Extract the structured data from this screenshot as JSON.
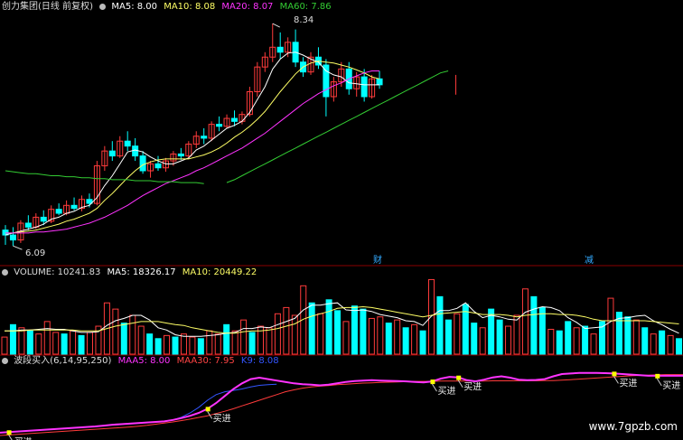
{
  "colors": {
    "up": "#ff3b3b",
    "down": "#00ffff",
    "ma5": "#ffffff",
    "ma10": "#ffff66",
    "ma20": "#ff33ff",
    "ma60": "#33cc33",
    "vol_ma5": "#ffffff",
    "vol_ma10": "#ffff66",
    "maa5": "#ff33ff",
    "maa30": "#ff3b3b",
    "k_line": "#3355ff",
    "signal": "#ffff00",
    "divider": "#8b0000"
  },
  "price_panel": {
    "title": "创力集团(日线 前复权)",
    "ma5_label": "MA5: 8.00",
    "ma10_label": "MA10: 8.08",
    "ma20_label": "MA20: 8.07",
    "ma60_label": "MA60: 7.86",
    "high_label": "8.34",
    "low_label": "6.09",
    "event_label_1": "财",
    "event_label_2": "减"
  },
  "volume_panel": {
    "vol_label": "VOLUME: 10241.83",
    "ma5_label": "MA5: 18326.17",
    "ma10_label": "MA10: 20449.22"
  },
  "wave_panel": {
    "title": "波段买入(6,14,95,250)",
    "maa5_label": "MAA5: 8.00",
    "maa30_label": "MAA30: 7.95",
    "k_label": "K9: 8.08",
    "buy_label": "买进"
  },
  "watermark": "www.7gpzb.com",
  "chart_data": {
    "type": "candlestick",
    "price_ylim": [
      6.0,
      8.45
    ],
    "candles": [
      [
        6.25,
        6.3,
        6.1,
        6.2
      ],
      [
        6.2,
        6.28,
        6.09,
        6.15
      ],
      [
        6.15,
        6.35,
        6.12,
        6.32
      ],
      [
        6.32,
        6.4,
        6.25,
        6.28
      ],
      [
        6.28,
        6.42,
        6.26,
        6.38
      ],
      [
        6.38,
        6.45,
        6.3,
        6.34
      ],
      [
        6.34,
        6.5,
        6.32,
        6.46
      ],
      [
        6.46,
        6.52,
        6.4,
        6.42
      ],
      [
        6.42,
        6.55,
        6.4,
        6.5
      ],
      [
        6.5,
        6.58,
        6.45,
        6.47
      ],
      [
        6.47,
        6.6,
        6.44,
        6.56
      ],
      [
        6.56,
        6.62,
        6.48,
        6.52
      ],
      [
        6.52,
        6.95,
        6.5,
        6.9
      ],
      [
        6.9,
        7.1,
        6.85,
        7.05
      ],
      [
        7.05,
        7.15,
        6.95,
        7.0
      ],
      [
        7.0,
        7.2,
        6.98,
        7.15
      ],
      [
        7.15,
        7.25,
        7.05,
        7.1
      ],
      [
        7.1,
        7.18,
        6.95,
        7.0
      ],
      [
        7.0,
        7.05,
        6.82,
        6.85
      ],
      [
        6.85,
        6.95,
        6.78,
        6.92
      ],
      [
        6.92,
        7.0,
        6.85,
        6.88
      ],
      [
        6.88,
        6.98,
        6.84,
        6.95
      ],
      [
        6.95,
        7.05,
        6.9,
        7.02
      ],
      [
        7.02,
        7.08,
        6.96,
        7.0
      ],
      [
        7.0,
        7.15,
        6.98,
        7.12
      ],
      [
        7.12,
        7.25,
        7.08,
        7.2
      ],
      [
        7.2,
        7.28,
        7.12,
        7.18
      ],
      [
        7.18,
        7.35,
        7.15,
        7.32
      ],
      [
        7.32,
        7.4,
        7.25,
        7.3
      ],
      [
        7.3,
        7.42,
        7.28,
        7.38
      ],
      [
        7.38,
        7.46,
        7.3,
        7.35
      ],
      [
        7.35,
        7.45,
        7.32,
        7.42
      ],
      [
        7.42,
        7.7,
        7.4,
        7.65
      ],
      [
        7.65,
        7.95,
        7.6,
        7.9
      ],
      [
        7.9,
        8.05,
        7.85,
        8.0
      ],
      [
        8.0,
        8.34,
        7.95,
        8.1
      ],
      [
        8.1,
        8.25,
        7.98,
        8.05
      ],
      [
        8.05,
        8.2,
        8.0,
        8.15
      ],
      [
        8.15,
        8.28,
        7.9,
        7.95
      ],
      [
        7.95,
        8.0,
        7.8,
        7.85
      ],
      [
        7.85,
        8.05,
        7.82,
        8.0
      ],
      [
        8.0,
        8.1,
        7.88,
        7.92
      ],
      [
        7.92,
        7.98,
        7.4,
        7.6
      ],
      [
        7.6,
        7.8,
        7.55,
        7.75
      ],
      [
        7.75,
        7.95,
        7.7,
        7.88
      ],
      [
        7.88,
        7.95,
        7.62,
        7.68
      ],
      [
        7.68,
        7.85,
        7.6,
        7.8
      ],
      [
        7.8,
        7.88,
        7.55,
        7.6
      ],
      [
        7.6,
        7.82,
        7.58,
        7.78
      ],
      [
        7.78,
        7.86,
        7.68,
        7.72
      ]
    ],
    "ma5": [
      6.2,
      6.22,
      6.24,
      6.26,
      6.28,
      6.31,
      6.36,
      6.38,
      6.42,
      6.44,
      6.48,
      6.5,
      6.58,
      6.7,
      6.8,
      6.92,
      7.04,
      7.06,
      7.04,
      6.99,
      6.95,
      6.92,
      6.92,
      6.95,
      6.98,
      7.06,
      7.1,
      7.16,
      7.22,
      7.28,
      7.31,
      7.35,
      7.44,
      7.57,
      7.7,
      7.88,
      7.98,
      8.04,
      8.05,
      8.02,
      7.98,
      7.95,
      7.86,
      7.82,
      7.8,
      7.74,
      7.73,
      7.72,
      7.72,
      7.72
    ],
    "ma10": [
      6.22,
      6.22,
      6.23,
      6.24,
      6.25,
      6.27,
      6.29,
      6.31,
      6.34,
      6.36,
      6.39,
      6.42,
      6.47,
      6.55,
      6.62,
      6.7,
      6.78,
      6.85,
      6.91,
      6.94,
      6.96,
      6.97,
      6.97,
      6.97,
      6.97,
      6.99,
      7.01,
      7.04,
      7.08,
      7.13,
      7.19,
      7.24,
      7.3,
      7.37,
      7.45,
      7.55,
      7.65,
      7.74,
      7.83,
      7.9,
      7.94,
      7.96,
      7.95,
      7.94,
      7.92,
      7.9,
      7.87,
      7.84,
      7.8,
      7.78
    ],
    "ma20": [
      6.22,
      6.22,
      6.22,
      6.22,
      6.23,
      6.23,
      6.24,
      6.25,
      6.26,
      6.28,
      6.3,
      6.32,
      6.35,
      6.38,
      6.42,
      6.46,
      6.5,
      6.55,
      6.6,
      6.64,
      6.68,
      6.72,
      6.75,
      6.78,
      6.81,
      6.85,
      6.88,
      6.92,
      6.96,
      7.0,
      7.04,
      7.08,
      7.13,
      7.18,
      7.23,
      7.29,
      7.35,
      7.41,
      7.47,
      7.53,
      7.58,
      7.63,
      7.67,
      7.71,
      7.74,
      7.78,
      7.81,
      7.84,
      7.86,
      7.86
    ],
    "ma60_segment_1": [
      6.85,
      6.84,
      6.83,
      6.82,
      6.82,
      6.81,
      6.8,
      6.8,
      6.79,
      6.79,
      6.78,
      6.78,
      6.77,
      6.77,
      6.76,
      6.76,
      6.76,
      6.75,
      6.75,
      6.75,
      6.74,
      6.74,
      6.74,
      6.73,
      6.73,
      6.73,
      6.72
    ],
    "ma60_segment_2_start": 29,
    "ma60_segment_2": [
      6.73,
      6.76,
      6.8,
      6.84,
      6.88,
      6.92,
      6.96,
      7.0,
      7.04,
      7.08,
      7.12,
      7.16,
      7.2,
      7.24,
      7.28,
      7.32,
      7.36,
      7.4,
      7.44,
      7.48,
      7.52,
      7.56,
      7.6,
      7.64,
      7.68,
      7.72,
      7.76,
      7.8,
      7.84,
      7.86
    ],
    "extra_candle": {
      "index": 59,
      "open": 7.82,
      "high": 7.82,
      "low": 7.62,
      "close": 7.65
    },
    "volume_ylim": [
      0,
      100
    ],
    "volume": [
      22,
      38,
      34,
      30,
      26,
      42,
      28,
      26,
      30,
      24,
      28,
      36,
      66,
      58,
      40,
      50,
      36,
      26,
      20,
      24,
      22,
      26,
      22,
      20,
      30,
      26,
      38,
      30,
      44,
      28,
      36,
      34,
      52,
      60,
      50,
      88,
      66,
      52,
      70,
      56,
      42,
      62,
      58,
      46,
      48,
      40,
      44,
      34,
      38,
      30,
      96,
      74,
      44,
      52,
      64,
      40,
      34,
      58,
      44,
      36,
      50,
      84,
      74,
      60,
      32,
      30,
      42,
      34,
      36,
      26,
      42,
      72,
      54,
      48,
      44,
      34,
      26,
      30,
      24,
      20
    ],
    "vol_up": [
      1,
      0,
      1,
      0,
      1,
      1,
      1,
      0,
      1,
      0,
      1,
      1,
      1,
      1,
      0,
      1,
      1,
      0,
      0,
      1,
      0,
      1,
      1,
      0,
      1,
      1,
      0,
      1,
      1,
      0,
      1,
      1,
      1,
      1,
      1,
      1,
      0,
      1,
      0,
      0,
      1,
      0,
      0,
      1,
      1,
      0,
      1,
      0,
      1,
      0,
      1,
      0,
      0,
      1,
      0,
      0,
      1,
      0,
      0,
      1,
      1,
      1,
      0,
      0,
      1,
      0,
      0,
      1,
      0,
      1,
      0,
      1,
      0,
      0,
      1,
      0,
      1,
      0,
      1,
      0
    ],
    "vol_ma5": [
      30,
      30,
      31,
      31,
      32,
      33,
      32,
      32,
      30,
      28,
      28,
      29,
      37,
      43,
      46,
      50,
      50,
      44,
      34,
      31,
      25,
      23,
      23,
      23,
      24,
      25,
      27,
      28,
      33,
      33,
      35,
      34,
      38,
      42,
      46,
      57,
      63,
      63,
      65,
      66,
      57,
      56,
      57,
      55,
      51,
      49,
      47,
      43,
      42,
      37,
      49,
      56,
      56,
      59,
      66,
      55,
      47,
      50,
      48,
      45,
      44,
      54,
      58,
      61,
      60,
      56,
      47,
      41,
      33,
      34,
      35,
      42,
      46,
      47,
      49,
      50,
      43,
      38,
      32,
      27
    ],
    "vol_ma10": [
      30,
      30,
      30,
      31,
      31,
      31,
      31,
      31,
      31,
      30,
      30,
      30,
      33,
      36,
      38,
      40,
      42,
      42,
      42,
      40,
      38,
      37,
      34,
      32,
      30,
      28,
      27,
      27,
      29,
      30,
      30,
      31,
      33,
      36,
      39,
      45,
      49,
      52,
      55,
      59,
      60,
      60,
      61,
      60,
      58,
      56,
      54,
      52,
      50,
      48,
      50,
      52,
      53,
      54,
      55,
      53,
      51,
      51,
      51,
      50,
      48,
      50,
      51,
      52,
      52,
      51,
      51,
      50,
      48,
      45,
      43,
      43,
      43,
      43,
      43,
      43,
      42,
      41,
      40,
      39
    ],
    "wave_ylim": [
      6.0,
      8.5
    ],
    "maa5": [
      6.1,
      6.12,
      6.14,
      6.16,
      6.18,
      6.2,
      6.22,
      6.24,
      6.26,
      6.28,
      6.3,
      6.32,
      6.35,
      6.38,
      6.4,
      6.42,
      6.44,
      6.46,
      6.48,
      6.5,
      6.55,
      6.62,
      6.7,
      6.8,
      6.95,
      7.15,
      7.4,
      7.65,
      7.85,
      8.0,
      8.05,
      8.0,
      7.95,
      7.9,
      7.85,
      7.82,
      7.8,
      7.78,
      7.8,
      7.85,
      7.9,
      7.93,
      7.95,
      7.96,
      7.95,
      7.94,
      7.93,
      7.92,
      7.9,
      7.88,
      7.92,
      8.02,
      8.08,
      8.06,
      7.96,
      7.92,
      7.98,
      8.06,
      8.1,
      8.05,
      7.98,
      7.96,
      7.97,
      8.0,
      8.1,
      8.18,
      8.2,
      8.22,
      8.22,
      8.22,
      8.21,
      8.2,
      8.18,
      8.16,
      8.14,
      8.12,
      8.12,
      8.12,
      8.12,
      8.12
    ],
    "maa30": [
      6.0,
      6.02,
      6.04,
      6.06,
      6.08,
      6.1,
      6.12,
      6.14,
      6.16,
      6.18,
      6.2,
      6.22,
      6.24,
      6.26,
      6.28,
      6.3,
      6.33,
      6.36,
      6.4,
      6.44,
      6.48,
      6.53,
      6.58,
      6.64,
      6.7,
      6.78,
      6.86,
      6.95,
      7.05,
      7.15,
      7.25,
      7.35,
      7.45,
      7.55,
      7.62,
      7.68,
      7.72,
      7.75,
      7.77,
      7.8,
      7.82,
      7.84,
      7.86,
      7.87,
      7.88,
      7.89,
      7.9,
      7.91,
      7.92,
      7.92,
      7.92,
      7.93,
      7.93,
      7.93,
      7.93,
      7.93,
      7.93,
      7.94,
      7.94,
      7.94,
      7.94,
      7.94,
      7.94,
      7.95,
      7.95,
      7.96,
      7.98,
      8.0,
      8.02,
      8.04,
      8.06,
      8.08,
      8.1,
      8.12,
      8.13,
      8.14,
      8.15,
      8.16,
      8.16,
      8.16
    ],
    "k_line_start": 20,
    "k_line": [
      6.55,
      6.65,
      6.8,
      7.0,
      7.25,
      7.45,
      7.55,
      7.6,
      7.65,
      7.72,
      7.78,
      7.8,
      7.82
    ],
    "buy_signal_indices": [
      1,
      24,
      50,
      53,
      71,
      76,
      80
    ]
  }
}
